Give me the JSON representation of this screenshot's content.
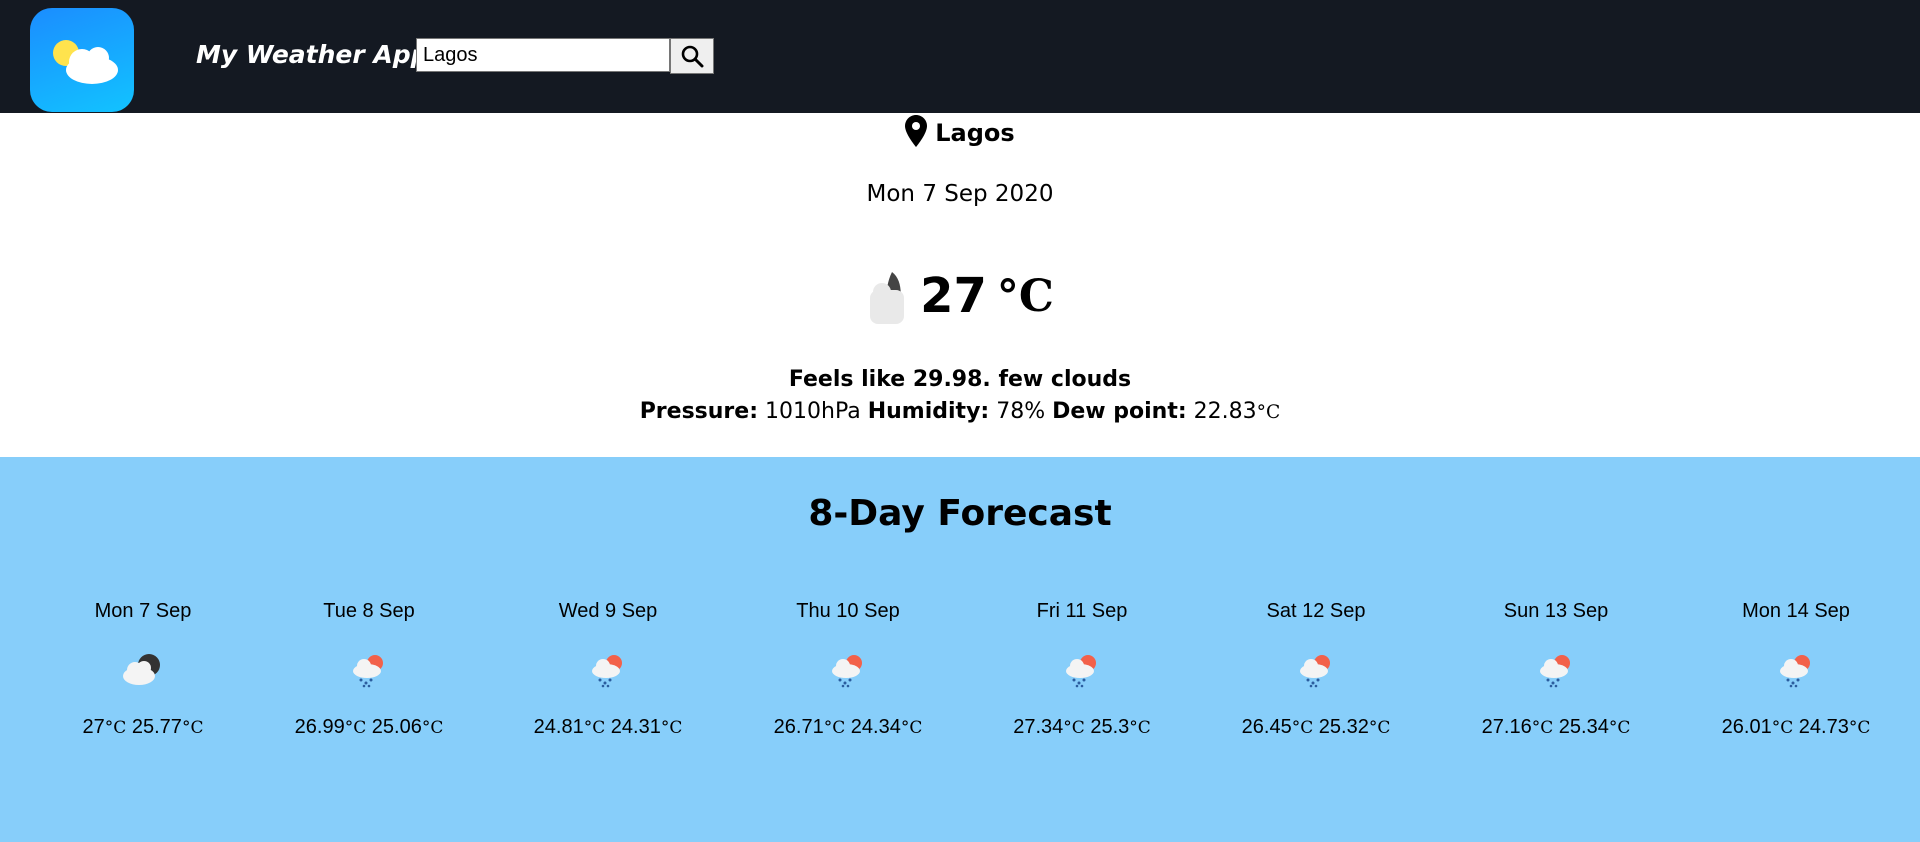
{
  "navbar": {
    "app_name": "My Weather App",
    "search_value": "Lagos",
    "logo_icon": "partly-cloudy-icon",
    "search_icon": "magnifier-icon"
  },
  "current": {
    "location": "Lagos",
    "date": "Mon 7 Sep 2020",
    "temp_value": "27",
    "temp_unit": "°C",
    "feels_like": "Feels like 29.98. few clouds",
    "pressure_label": "Pressure:",
    "pressure_value": "1010hPa",
    "humidity_label": "Humidity:",
    "humidity_value": "78%",
    "dew_label": "Dew point:",
    "dew_value": "22.83",
    "dew_unit": "°C",
    "icon": "few-clouds-night-icon"
  },
  "forecast": {
    "title": "8-Day Forecast",
    "unit": "°C",
    "days": [
      {
        "label": "Mon 7 Sep",
        "high": "27",
        "low": "25.77",
        "icon": "cloud-moon-icon"
      },
      {
        "label": "Tue 8 Sep",
        "high": "26.99",
        "low": "25.06",
        "icon": "rain-sun-icon"
      },
      {
        "label": "Wed 9 Sep",
        "high": "24.81",
        "low": "24.31",
        "icon": "rain-sun-icon"
      },
      {
        "label": "Thu 10 Sep",
        "high": "26.71",
        "low": "24.34",
        "icon": "rain-sun-icon"
      },
      {
        "label": "Fri 11 Sep",
        "high": "27.34",
        "low": "25.3",
        "icon": "rain-sun-icon"
      },
      {
        "label": "Sat 12 Sep",
        "high": "26.45",
        "low": "25.32",
        "icon": "rain-sun-icon"
      },
      {
        "label": "Sun 13 Sep",
        "high": "27.16",
        "low": "25.34",
        "icon": "rain-sun-icon"
      },
      {
        "label": "Mon 14 Sep",
        "high": "26.01",
        "low": "24.73",
        "icon": "rain-sun-icon"
      }
    ]
  },
  "colors": {
    "navbar_bg": "#141922",
    "forecast_bg": "#87cefa",
    "logo_gradient_start": "#1b8dff",
    "logo_gradient_end": "#12c3ff"
  }
}
